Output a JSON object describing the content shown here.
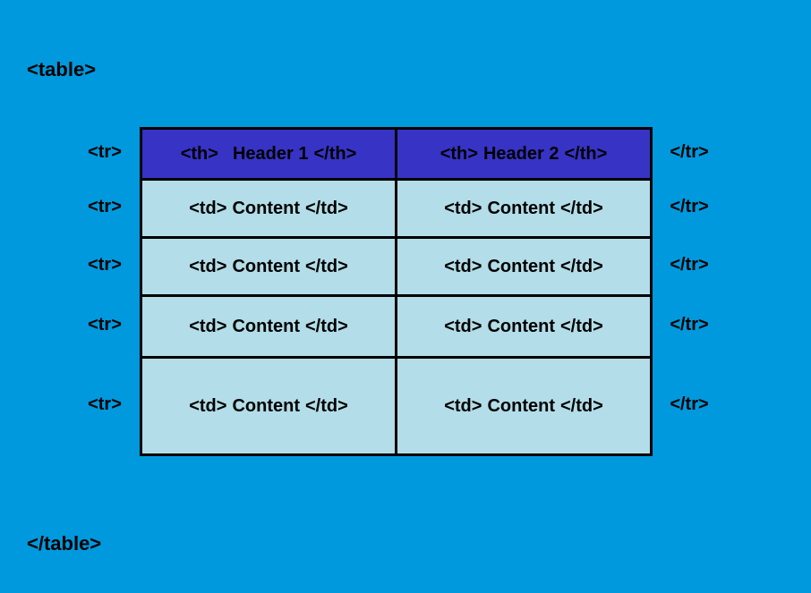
{
  "tags": {
    "table_open": "<table>",
    "table_close": "</table>",
    "tr_open": "<tr>",
    "tr_close": "</tr>",
    "th_open": "<th>",
    "th_close": "</th>",
    "td_open": "<td>",
    "td_close": "</td>"
  },
  "headers": {
    "h1": "Header 1",
    "h2": "Header 2"
  },
  "rows": [
    {
      "c1": "Content",
      "c2": "Content"
    },
    {
      "c1": "Content",
      "c2": "Content"
    },
    {
      "c1": "Content",
      "c2": "Content"
    },
    {
      "c1": "Content",
      "c2": "Content"
    }
  ]
}
